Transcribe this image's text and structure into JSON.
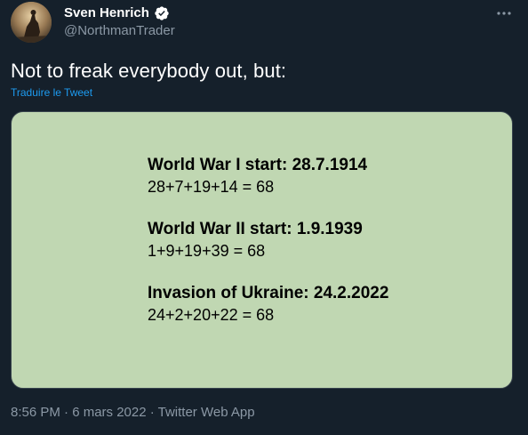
{
  "author": {
    "display_name": "Sven Henrich",
    "handle": "@NorthmanTrader",
    "avatar_icon": "avatar-silhouette-icon",
    "verified_icon": "verified-badge-icon"
  },
  "tweet": {
    "text": "Not to freak everybody out, but:",
    "translate_label": "Traduire le Tweet",
    "timestamp": "8:56 PM · 6 mars 2022 · Twitter Web App"
  },
  "media": {
    "background_color": "#c0d7b2",
    "sections": [
      {
        "heading": "World War I start: 28.7.1914",
        "sum": "28+7+19+14 = 68"
      },
      {
        "heading": "World War II start: 1.9.1939",
        "sum": "1+9+19+39 = 68"
      },
      {
        "heading": "Invasion of Ukraine: 24.2.2022",
        "sum": "24+2+20+22 = 68"
      }
    ]
  },
  "menu": {
    "more_icon": "more-options-icon"
  },
  "colors": {
    "background": "#15202b",
    "text_primary": "#ffffff",
    "text_secondary": "#8b98a5",
    "link": "#1d9bf0",
    "verified": "#1d9bf0"
  }
}
